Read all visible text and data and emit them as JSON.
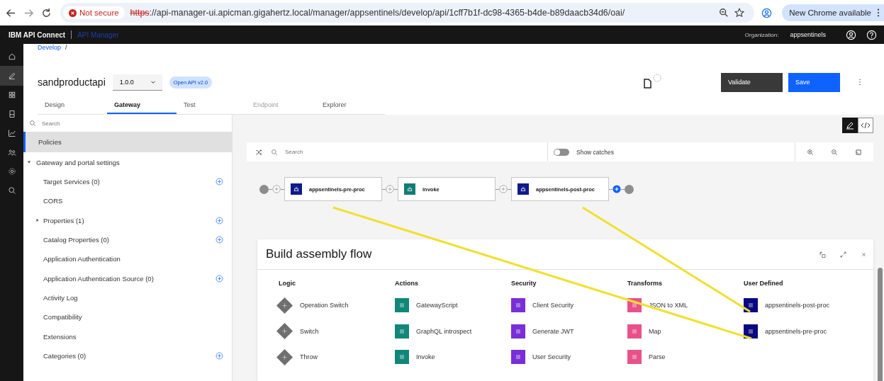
{
  "browser": {
    "not_secure": "Not secure",
    "url_scheme": "https",
    "url_rest": "://api-manager-ui.apicman.gigahertz.local/manager/appsentinels/develop/api/1cff7b1f-dc98-4365-b4de-b89daacb34d6/oai/",
    "update": "New Chrome available"
  },
  "header": {
    "brand": "IBM API Connect",
    "product": "API Manager",
    "org_label": "Organization:",
    "org": "appsentinels"
  },
  "breadcrumb": {
    "link": "Develop",
    "separator": "/"
  },
  "api": {
    "name": "sandproductapi",
    "version": "1.0.0",
    "badge": "Open API v2.0"
  },
  "actions": [
    {
      "label": "Validate",
      "kind": "secondary"
    },
    {
      "label": "Save",
      "kind": "primary"
    }
  ],
  "tabs": [
    {
      "label": "Design",
      "selected": false,
      "disabled": false
    },
    {
      "label": "Gateway",
      "selected": true,
      "disabled": false
    },
    {
      "label": "Test",
      "selected": false,
      "disabled": false
    },
    {
      "label": "Endpoint",
      "selected": false,
      "disabled": true
    },
    {
      "label": "Explorer",
      "selected": false,
      "disabled": false
    }
  ],
  "sidebar": {
    "search_placeholder": "Search",
    "top": [
      {
        "label": "Policies",
        "selected": true
      }
    ],
    "group": {
      "label": "Gateway and portal settings",
      "expanded": true,
      "children": [
        {
          "label": "Target Services (0)",
          "add": true
        },
        {
          "label": "CORS",
          "add": false
        },
        {
          "label": "Properties (1)",
          "add": true,
          "expanded": false
        },
        {
          "label": "Catalog Properties (0)",
          "add": true
        },
        {
          "label": "Application Authentication",
          "add": false
        },
        {
          "label": "Application Authentication Source (0)",
          "add": true
        },
        {
          "label": "Activity Log",
          "add": false
        },
        {
          "label": "Compatibility",
          "add": false
        },
        {
          "label": "Extensions",
          "add": false
        },
        {
          "label": "Categories (0)",
          "add": true
        }
      ]
    }
  },
  "canvas": {
    "search_placeholder": "Search",
    "toggle": {
      "label": "Show catches",
      "on": false
    },
    "flow": [
      {
        "label": "appsentinels-pre-proc",
        "color": "#0f1a8c"
      },
      {
        "label": "invoke",
        "color": "#0f7d74"
      },
      {
        "label": "appsentinels-post-proc",
        "color": "#0f1a8c"
      }
    ]
  },
  "palette": {
    "title": "Build assembly flow",
    "columns": [
      {
        "heading": "Logic",
        "items": [
          {
            "label": "Operation Switch",
            "kind": "diamond",
            "color": "#6f6f6f"
          },
          {
            "label": "Switch",
            "kind": "diamond",
            "color": "#6f6f6f"
          },
          {
            "label": "Throw",
            "kind": "diamond",
            "color": "#6f6f6f"
          }
        ]
      },
      {
        "heading": "Actions",
        "items": [
          {
            "label": "GatewayScript",
            "kind": "tile",
            "color": "#118778"
          },
          {
            "label": "GraphQL introspect",
            "kind": "tile",
            "color": "#118778"
          },
          {
            "label": "Invoke",
            "kind": "tile",
            "color": "#118778"
          }
        ]
      },
      {
        "heading": "Security",
        "items": [
          {
            "label": "Client Security",
            "kind": "tile",
            "color": "#7a2ed6"
          },
          {
            "label": "Generate JWT",
            "kind": "tile",
            "color": "#7a2ed6"
          },
          {
            "label": "User Security",
            "kind": "tile",
            "color": "#7a2ed6"
          }
        ]
      },
      {
        "heading": "Transforms",
        "items": [
          {
            "label": "JSON to XML",
            "kind": "tile",
            "color": "#e8528a"
          },
          {
            "label": "Map",
            "kind": "tile",
            "color": "#e8528a"
          },
          {
            "label": "Parse",
            "kind": "tile",
            "color": "#e8528a"
          }
        ]
      },
      {
        "heading": "User Defined",
        "items": [
          {
            "label": "appsentinels-post-proc",
            "kind": "tile",
            "color": "#0a0a80"
          },
          {
            "label": "appsentinels-pre-proc",
            "kind": "tile",
            "color": "#0a0a80"
          }
        ]
      }
    ]
  }
}
